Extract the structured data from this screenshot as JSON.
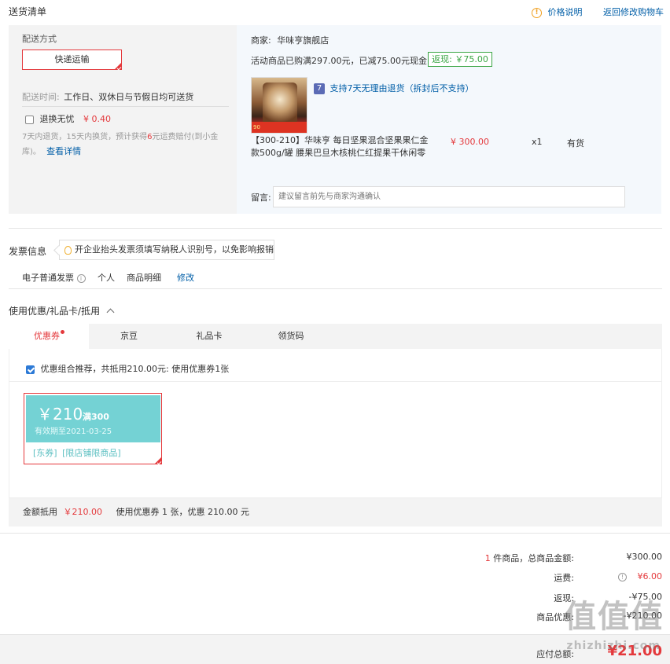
{
  "delivery": {
    "title": "送货清单",
    "price_info": "价格说明",
    "back_to_cart": "返回修改购物车",
    "ship_method_label": "配送方式",
    "ship_method": "快递运输",
    "ship_time_label": "配送时间:",
    "ship_time": "工作日、双休日与节假日均可送货",
    "return_service": "退换无忧",
    "return_price": "¥ 0.40",
    "return_desc_1": "7天内退货，15天内换货，预计获得",
    "return_desc_num": "6",
    "return_desc_2": "元运费赔付(到小金",
    "return_desc_3": "库)。",
    "see_detail": "查看详情"
  },
  "shop": {
    "merchant_label": "商家:",
    "merchant": "华味亨旗舰店",
    "promo": "活动商品已购满297.00元，已减75.00元现金",
    "rebate": "返现: ￥75.00",
    "seven_day": "支持7天无理由退货（拆封后不支持）",
    "product_line1": "【300-210】华味亨 每日坚果混合坚果果仁金",
    "product_line2": "款500g/罐 腰果巴旦木核桃仁红提果干休闲零",
    "product_price": "¥ 300.00",
    "product_qty": "x1",
    "product_stock": "有货",
    "img_badge_num": "90",
    "message_label": "留言:",
    "message_placeholder": "建议留言前先与商家沟通确认"
  },
  "invoice": {
    "title": "发票信息",
    "tip": "开企业抬头发票须填写纳税人识别号，以免影响报销",
    "type": "电子普通发票",
    "person": "个人",
    "detail": "商品明细",
    "modify": "修改"
  },
  "coupons": {
    "title": "使用优惠/礼品卡/抵用",
    "tabs": [
      "优惠券",
      "京豆",
      "礼品卡",
      "领货码"
    ],
    "recommend": "优惠组合推荐，共抵用210.00元: 使用优惠券1张",
    "coupon_amount": "￥210",
    "coupon_cond": "满300",
    "coupon_expire": "有效期至2021-03-25",
    "coupon_tag1": "[东券]",
    "coupon_tag2": "[限店铺限商品]",
    "summary_label": "金额抵用",
    "summary_amount": "￥210.00",
    "summary_desc": "使用优惠券 1 张，优惠 210.00 元"
  },
  "totals": {
    "count": "1",
    "count_label": "件商品，总商品金额:",
    "goods_total": "¥300.00",
    "freight_label": "运费:",
    "freight": "¥6.00",
    "rebate_label": "返现:",
    "rebate": "-¥75.00",
    "goods_label": "商品优惠:",
    "goods_discount": "-¥210.00",
    "payable_label": "应付总额:",
    "payable": "¥21.00"
  },
  "watermark": {
    "logo": "值值值",
    "domain": "zhizhizhi.com"
  }
}
